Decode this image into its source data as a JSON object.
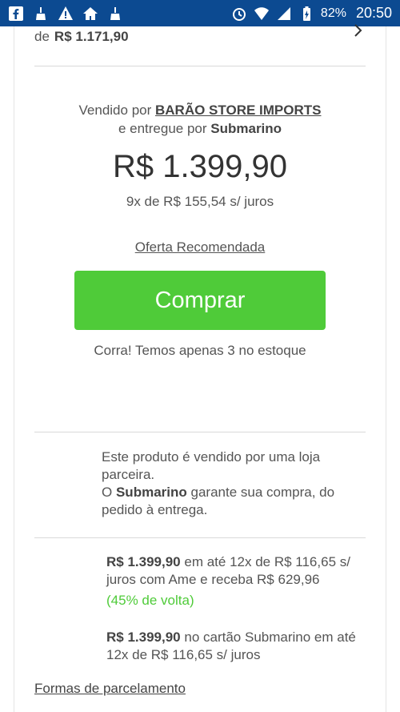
{
  "status_bar": {
    "battery": "82%",
    "time": "20:50",
    "left_icons": [
      "facebook-icon",
      "broom-icon",
      "warning-icon",
      "home-icon",
      "broom-icon"
    ],
    "right_icons": [
      "alarm-icon",
      "wifi-icon",
      "signal-icon",
      "battery-icon"
    ]
  },
  "previous_offer": {
    "prefix": "de",
    "price": "R$ 1.171,90"
  },
  "seller": {
    "sold_by_prefix": "Vendido por",
    "seller_name": "BARÃO STORE IMPORTS",
    "delivered_by_prefix": "e entregue por",
    "delivered_by": "Submarino"
  },
  "price": "R$ 1.399,90",
  "installments": "9x de R$ 155,54 s/ juros",
  "recommended_offer_link": "Oferta Recomendada",
  "buy_button": "Comprar",
  "stock_notice": "Corra! Temos apenas 3 no estoque",
  "partner_notice": {
    "line1": "Este produto é vendido por uma loja parceira.",
    "line2_prefix": "O",
    "line2_brand": "Submarino",
    "line2_suffix": "garante sua compra, do pedido à entrega."
  },
  "promos": [
    {
      "price": "R$ 1.399,90",
      "text": "em até 12x de R$ 116,65 s/ juros com Ame e receba R$ 629,96",
      "cashback": "(45% de volta)"
    },
    {
      "price": "R$ 1.399,90",
      "text": "no cartão Submarino em até 12x de R$ 116,65 s/ juros"
    }
  ],
  "installment_forms_link": "Formas de parcelamento",
  "colors": {
    "status_bar": "#0c4a91",
    "buy_button": "#4fcb39",
    "cashback_text": "#4fcb39"
  }
}
